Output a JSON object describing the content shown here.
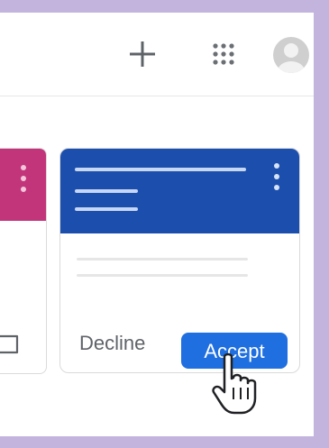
{
  "toolbar": {
    "plus_icon": "plus-icon",
    "apps_icon": "apps-grid-icon",
    "avatar_icon": "user-avatar-icon"
  },
  "cards": {
    "left_card": {
      "header_color": "#c2357a",
      "icon": "folder-icon"
    },
    "invite_card": {
      "header_color": "#1c4fad",
      "decline_label": "Decline",
      "accept_label": "Accept",
      "accept_color": "#1f6fe0"
    }
  },
  "cursor": {
    "icon": "hand-pointer-icon"
  },
  "colors": {
    "frame": "#c3b4de",
    "window": "#ffffff"
  }
}
